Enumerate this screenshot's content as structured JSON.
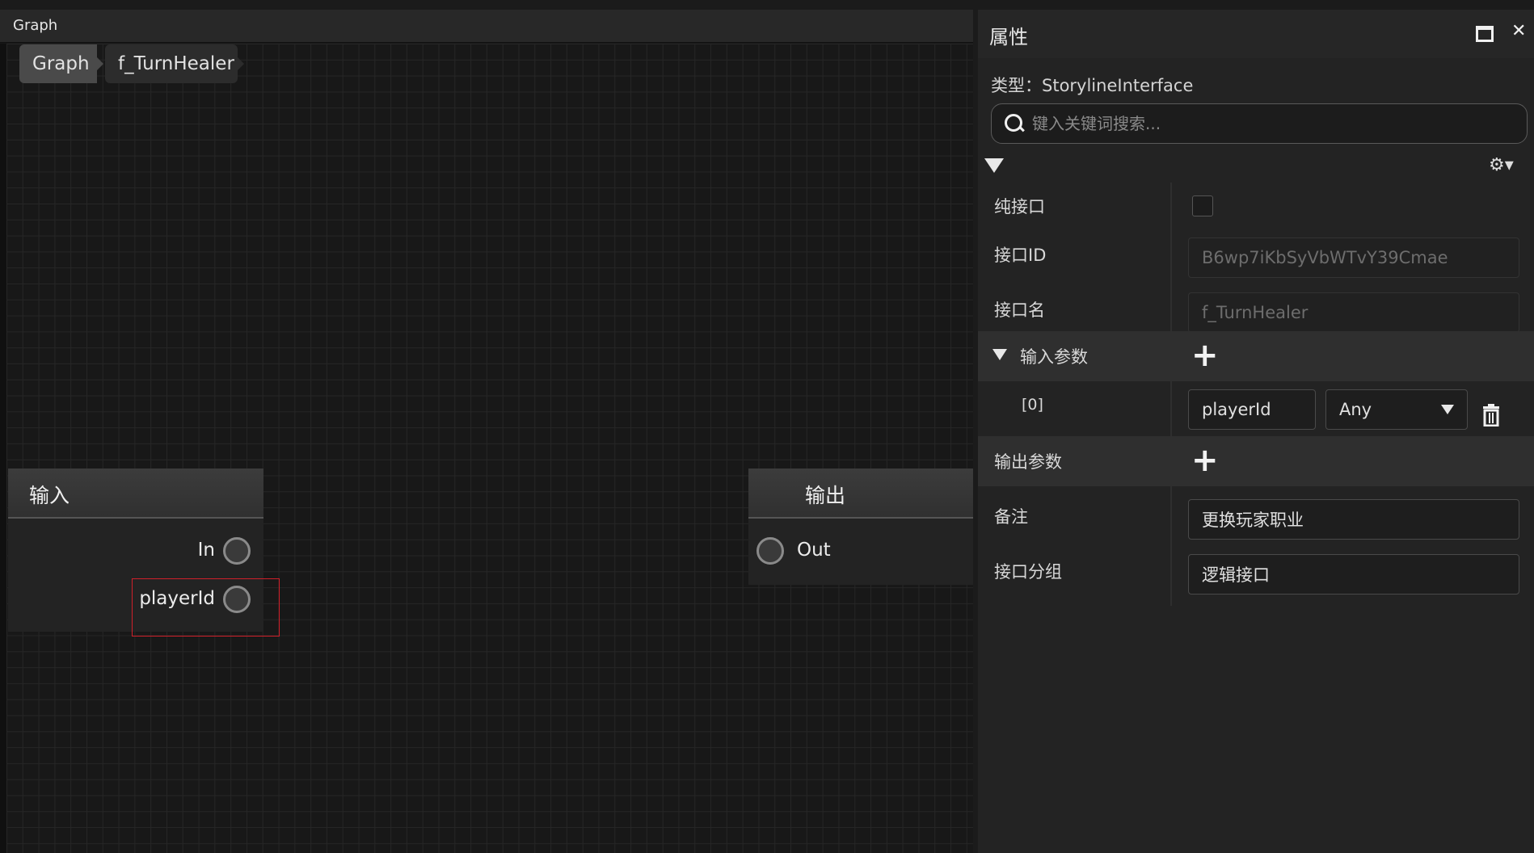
{
  "graph": {
    "panel_title": "Graph",
    "breadcrumb": [
      "Graph",
      "f_TurnHealer"
    ],
    "input_node": {
      "title": "输入",
      "ports": [
        "In",
        "playerId"
      ]
    },
    "output_node": {
      "title": "输出",
      "ports": [
        "Out"
      ]
    }
  },
  "properties": {
    "title": "属性",
    "type_line": "类型：StorylineInterface",
    "search_placeholder": "键入关键词搜索...",
    "pure_interface_label": "纯接口",
    "pure_interface_checked": false,
    "interface_id_label": "接口ID",
    "interface_id_value": "B6wp7iKbSyVbWTvY39Cmae",
    "interface_name_label": "接口名",
    "interface_name_value": "f_TurnHealer",
    "input_params_label": "输入参数",
    "input_params": [
      {
        "index": "[0]",
        "name": "playerId",
        "type": "Any"
      }
    ],
    "output_params_label": "输出参数",
    "note_label": "备注",
    "note_value": "更换玩家职业",
    "group_label": "接口分组",
    "group_value": "逻辑接口"
  }
}
